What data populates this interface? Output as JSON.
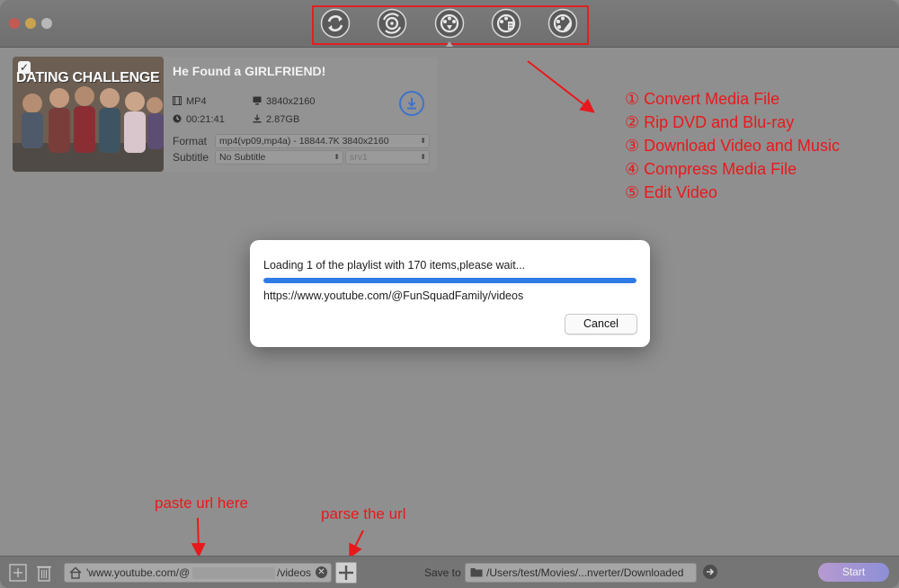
{
  "toolbar": {
    "tools": [
      {
        "icon": "convert-icon"
      },
      {
        "icon": "rip-dvd-icon"
      },
      {
        "icon": "download-video-icon"
      },
      {
        "icon": "compress-icon"
      },
      {
        "icon": "edit-video-icon"
      }
    ]
  },
  "video": {
    "thumbnail_text": "DATING CHALLENGE",
    "title": "He Found a GIRLFRIEND!",
    "container": "MP4",
    "resolution": "3840x2160",
    "duration": "00:21:41",
    "size": "2.87GB",
    "format_label": "Format",
    "format_value": "mp4(vp09,mp4a) - 18844.7K 3840x2160",
    "subtitle_label": "Subtitle",
    "subtitle_value": "No Subtitle",
    "subtitle_format": "srv1"
  },
  "annotations": {
    "features": [
      "① Convert Media File",
      "② Rip DVD and Blu-ray",
      "③ Download Video and Music",
      "④ Compress Media File",
      "⑤ Edit Video"
    ],
    "paste_hint": "paste url here",
    "parse_hint": "parse the url"
  },
  "dialog": {
    "message": "Loading 1 of the playlist with 170 items,please wait...",
    "url": "https://www.youtube.com/@FunSquadFamily/videos",
    "progress_fraction": 1.0,
    "cancel_label": "Cancel"
  },
  "bottom": {
    "url_prefix": "'www.youtube.com/@",
    "url_suffix": "/videos",
    "save_to_label": "Save to",
    "save_path": "/Users/test/Movies/...nverter/Downloaded",
    "start_label": "Start"
  },
  "colors": {
    "accent_blue": "#2f7be6",
    "annotation_red": "#e8191c"
  }
}
